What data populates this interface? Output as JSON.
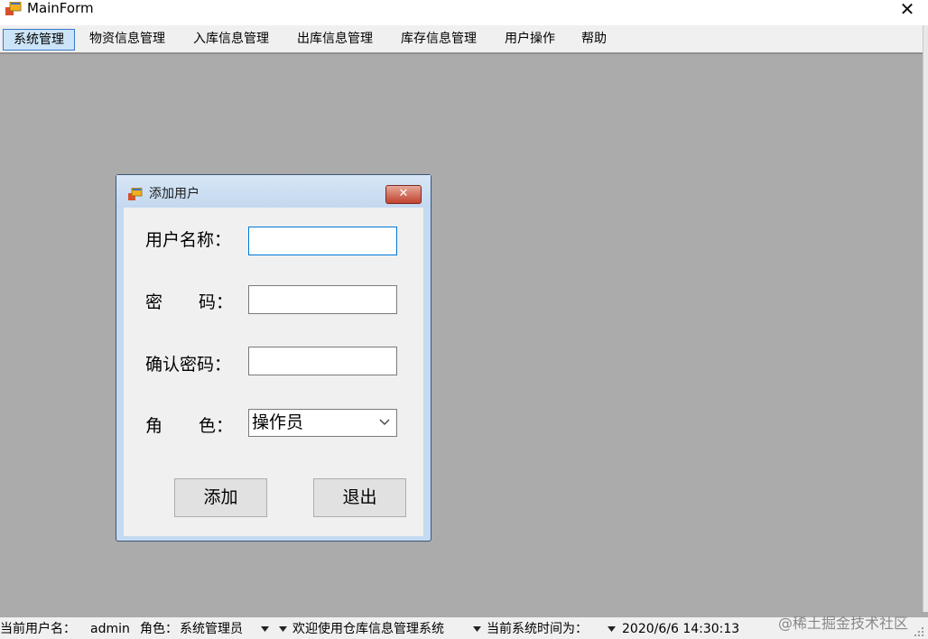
{
  "window": {
    "title": "MainForm",
    "close_glyph": "✕",
    "icon": "app-form-icon"
  },
  "menu": {
    "items": [
      {
        "label": "系统管理",
        "active": true
      },
      {
        "label": "物资信息管理"
      },
      {
        "label": "入库信息管理"
      },
      {
        "label": "出库信息管理"
      },
      {
        "label": "库存信息管理"
      },
      {
        "label": "用户操作"
      },
      {
        "label": "帮助"
      }
    ]
  },
  "dialog": {
    "title": "添加用户",
    "close_glyph": "✕",
    "fields": {
      "username_label": "用户名称：",
      "username_value": "",
      "password_label_a": "密",
      "password_label_b": "码：",
      "password_value": "",
      "confirm_label": "确认密码：",
      "confirm_value": "",
      "role_label_a": "角",
      "role_label_b": "色：",
      "role_value": "操作员"
    },
    "buttons": {
      "add": "添加",
      "exit": "退出"
    }
  },
  "statusbar": {
    "user_label": "当前用户名：",
    "user_value": "admin",
    "role_label": "角色：",
    "role_value": "系统管理员",
    "welcome": "欢迎使用仓库信息管理系统",
    "time_label": "当前系统时间为：",
    "time_value": "2020/6/6 14:30:13"
  },
  "watermark": "@稀土掘金技术社区",
  "colors": {
    "mdi_background": "#ababab",
    "menu_active_border": "#3a78c8",
    "dialog_frame": "#c5daf0",
    "dialog_close": "#c2432e"
  }
}
